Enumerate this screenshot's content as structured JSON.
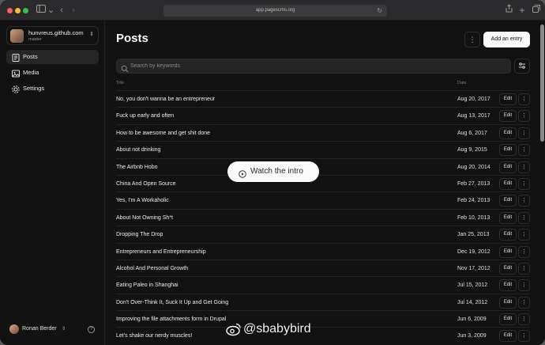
{
  "browser": {
    "url": "app.pagescms.org"
  },
  "repo": {
    "name": "hunvreus.github.com",
    "branch": "master"
  },
  "nav": [
    {
      "label": "Posts",
      "icon": "posts-icon"
    },
    {
      "label": "Media",
      "icon": "media-icon"
    },
    {
      "label": "Settings",
      "icon": "settings-icon"
    }
  ],
  "user": {
    "name": "Ronan Berder"
  },
  "page": {
    "title": "Posts",
    "add_label": "Add an entry",
    "search_placeholder": "Search by keywords",
    "col_title": "Title",
    "col_date": "Date",
    "edit_label": "Edit"
  },
  "rows": [
    {
      "title": "No, you don't wanna be an entrepreneur",
      "date": "Aug 20, 2017"
    },
    {
      "title": "Fuck up early and often",
      "date": "Aug 13, 2017"
    },
    {
      "title": "How to be awesome and get shit done",
      "date": "Aug 6, 2017"
    },
    {
      "title": "About not drinking",
      "date": "Aug 9, 2015"
    },
    {
      "title": "The Airbnb Hobo",
      "date": "Aug 20, 2014"
    },
    {
      "title": "China And Open Source",
      "date": "Feb 27, 2013"
    },
    {
      "title": "Yes, I'm A Workaholic",
      "date": "Feb 24, 2013"
    },
    {
      "title": "About Not Owning Sh*t",
      "date": "Feb 10, 2013"
    },
    {
      "title": "Dropping The Drop",
      "date": "Jan 25, 2013"
    },
    {
      "title": "Entrepreneurs and Entrepreneurship",
      "date": "Dec 19, 2012"
    },
    {
      "title": "Alcohol And Personal Growth",
      "date": "Nov 17, 2012"
    },
    {
      "title": "Eating Paleo in Shanghai",
      "date": "Jul 15, 2012"
    },
    {
      "title": "Don't Over-Think It, Suck It Up and Get Going",
      "date": "Jul 14, 2012"
    },
    {
      "title": "Improving the file attachments form in Drupal",
      "date": "Jun 6, 2009"
    },
    {
      "title": "Let's shake our nerdy muscles!",
      "date": "Jun 3, 2009"
    }
  ],
  "overlay": {
    "intro_label": "Watch the intro"
  },
  "watermark": {
    "text": "@sbabybird"
  },
  "colors": {
    "background": "#121212",
    "primary_button": "#fafafa",
    "border": "#232323"
  }
}
